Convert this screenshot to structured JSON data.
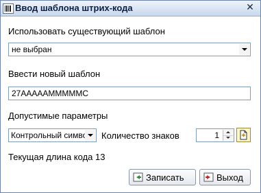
{
  "window": {
    "title": "Ввод шаблона штрих-кода",
    "close_glyph": "✕",
    "icons": {
      "title": "barcode-icon",
      "close": "close-icon"
    }
  },
  "existing_template": {
    "label": "Использовать существующий шаблон",
    "selected": "не выбран"
  },
  "new_template": {
    "label": "Ввести новый шаблон",
    "value": "27AAAAAMMMMMC"
  },
  "params": {
    "label": "Допустимые параметры",
    "type_selected": "Контрольный символ",
    "count_label": "Количество знаков",
    "count_value": "1"
  },
  "current_length": {
    "text": "Текущая длина кода 13"
  },
  "buttons": {
    "save": "Записать",
    "exit": "Выход"
  },
  "colors": {
    "title_text": "#0b1f45",
    "save_icon": "#2e8b3a",
    "exit_icon": "#c0282d"
  }
}
